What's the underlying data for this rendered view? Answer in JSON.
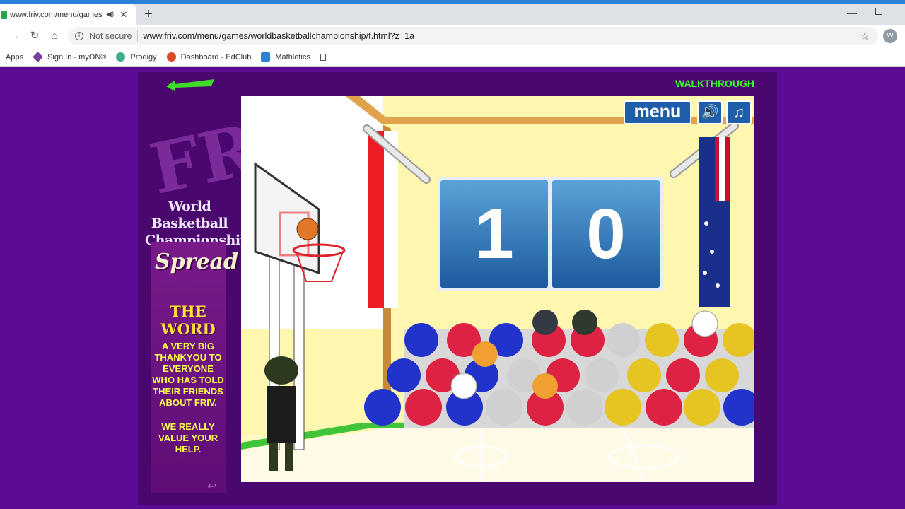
{
  "browser": {
    "tab_title": "www.friv.com/menu/games/",
    "new_tab_label": "+",
    "url_security": "Not secure",
    "url": "www.friv.com/menu/games/worldbasketballchampionship/f.html?z=1a",
    "profile_initial": "W",
    "bookmarks": [
      {
        "label": "Apps"
      },
      {
        "label": "Sign In - myON®",
        "color": "#7b3fa0"
      },
      {
        "label": "Prodigy",
        "color": "#3fae8c"
      },
      {
        "label": "Dashboard - EdClub",
        "color": "#d94c2a"
      },
      {
        "label": "Mathletics",
        "color": "#2d7fd1"
      }
    ]
  },
  "page": {
    "walkthrough": "WALKTHROUGH",
    "game_title": "World Basketball Championship",
    "spread": {
      "title": "Spread",
      "subtitle": "THE WORD",
      "message": "A VERY BIG THANKYOU TO EVERYONE WHO HAS TOLD THEIR FRIENDS ABOUT FRIV.",
      "message2": "WE REALLY VALUE YOUR HELP."
    }
  },
  "game": {
    "menu_label": "menu",
    "score_left": "1",
    "score_right": "0",
    "colors": {
      "button_blue": "#1f5ea8",
      "score_blue": "#2e74b8",
      "floor": "#fffbe6",
      "court_line": "#ffffff"
    }
  }
}
